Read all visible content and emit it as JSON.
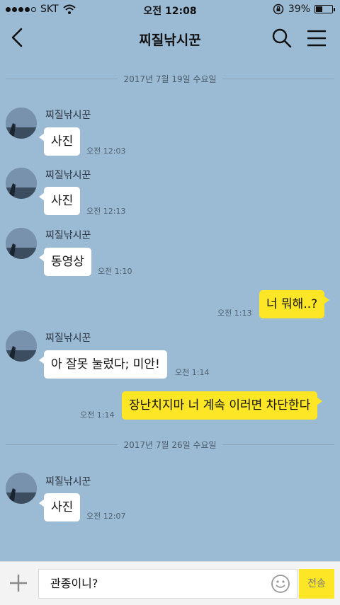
{
  "status_bar": {
    "carrier": "SKT",
    "time": "오전 12:08",
    "battery_text": "39%",
    "battery_level": 0.39,
    "signal_bars_filled": 4,
    "signal_bars_total": 5
  },
  "header": {
    "title": "찌질낚시꾼",
    "back_icon": "chevron-left-icon",
    "search_icon": "search-icon",
    "menu_icon": "hamburger-menu-icon"
  },
  "dates": [
    "2017년 7월 19일 수요일",
    "2017년 7월 26일 수요일"
  ],
  "messages": [
    {
      "sender": "찌질낚시꾼",
      "text": "사진",
      "time": "오전 12:03"
    },
    {
      "sender": "찌질낚시꾼",
      "text": "사진",
      "time": "오전 12:13"
    },
    {
      "sender": "찌질낚시꾼",
      "text": "동영상",
      "time": "오전 1:10"
    },
    {
      "text": "너 뭐해..?",
      "time": "오전 1:13"
    },
    {
      "sender": "찌질낚시꾼",
      "text": "아 잘못 눌렀다; 미안!",
      "time": "오전 1:14"
    },
    {
      "text": "장난치지마 너 계속 이러면 차단한다",
      "time": "오전 1:14"
    },
    {
      "sender": "찌질낚시꾼",
      "text": "사진",
      "time": "오전 12:07"
    }
  ],
  "input": {
    "value": "관종이니?",
    "send_label": "전송",
    "plus_icon": "plus-icon",
    "emoji_icon": "emoji-icon"
  },
  "colors": {
    "background": "#9bbbd4",
    "my_bubble": "#fde626",
    "their_bubble": "#ffffff"
  }
}
